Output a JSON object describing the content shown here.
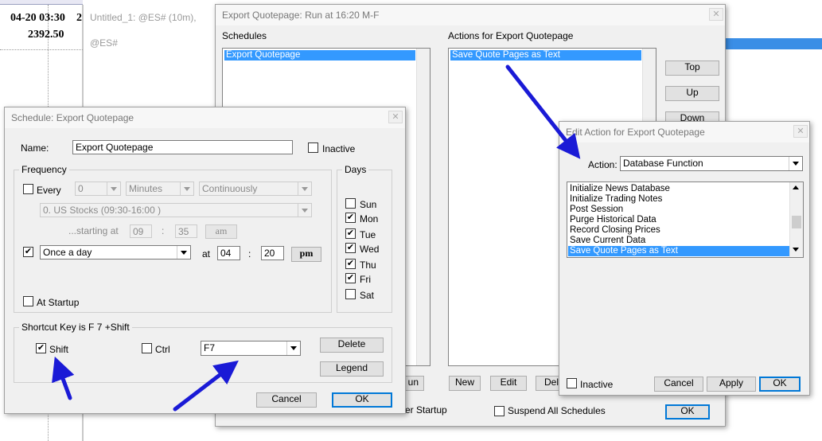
{
  "chart_window": {
    "date_time": "04-20 03:30",
    "extra_digit": "2",
    "price": "2392.50"
  },
  "untitled_window": {
    "title": "Untitled_1: @ES# (10m), @ES#"
  },
  "export_window": {
    "title": "Export Quotepage: Run at 16:20  M-F",
    "schedules_label": "Schedules",
    "schedules": [
      "Export Quotepage"
    ],
    "actions_label": "Actions for Export Quotepage",
    "actions": [
      "Save Quote Pages as Text"
    ],
    "top_btn": "Top",
    "up_btn": "Up",
    "down_btn": "Down",
    "run_btn_partial": "un",
    "new_btn": "New",
    "edit_btn": "Edit",
    "del_btn_partial": "Del",
    "after_startup_partial": "er Startup",
    "suspend_label": "Suspend All Schedules",
    "ok_btn": "OK",
    "close_glyph": "✕"
  },
  "schedule_dialog": {
    "title": "Schedule: Export Quotepage",
    "name_label": "Name:",
    "name_value": "Export Quotepage",
    "inactive_label": "Inactive",
    "frequency_label": "Frequency",
    "every_label": "Every",
    "every_value": "0",
    "unit_value": "Minutes",
    "mode_value": "Continuously",
    "session_value": "0. US Stocks (09:30-16:00 )",
    "starting_label": "...starting at",
    "start_hour": "09",
    "start_min": "35",
    "start_ampm": "am",
    "once_value": "Once a day",
    "at_label": "at",
    "at_hour": "04",
    "at_min": "20",
    "at_ampm": "pm",
    "colon": ":",
    "at_startup_label": "At Startup",
    "days_label": "Days",
    "days": [
      {
        "name": "Sun",
        "checked": false
      },
      {
        "name": "Mon",
        "checked": true
      },
      {
        "name": "Tue",
        "checked": true
      },
      {
        "name": "Wed",
        "checked": true
      },
      {
        "name": "Thu",
        "checked": true
      },
      {
        "name": "Fri",
        "checked": true
      },
      {
        "name": "Sat",
        "checked": false
      }
    ],
    "shortcut_label": "Shortcut Key is F 7 +Shift",
    "shift_label": "Shift",
    "ctrl_label": "Ctrl",
    "key_value": "F7",
    "delete_btn": "Delete",
    "legend_btn": "Legend",
    "cancel_btn": "Cancel",
    "ok_btn": "OK",
    "check_glyph": "✔",
    "close_glyph": "✕"
  },
  "edit_action_dialog": {
    "title": "Edit Action for Export Quotepage",
    "action_label": "Action:",
    "action_value": "Database Function",
    "functions": [
      "Initialize News Database",
      "Initialize Trading Notes",
      "Post Session",
      "Purge Historical Data",
      "Record Closing Prices",
      "Save Current Data",
      "Save Quote Pages as Text"
    ],
    "selected_index": 6,
    "inactive_label": "Inactive",
    "cancel_btn": "Cancel",
    "apply_btn": "Apply",
    "ok_btn": "OK",
    "close_glyph": "✕"
  },
  "colors": {
    "selection": "#3399ff",
    "annotation_arrow": "#1a1ad6",
    "accent_bar": "#3a8ee6"
  }
}
